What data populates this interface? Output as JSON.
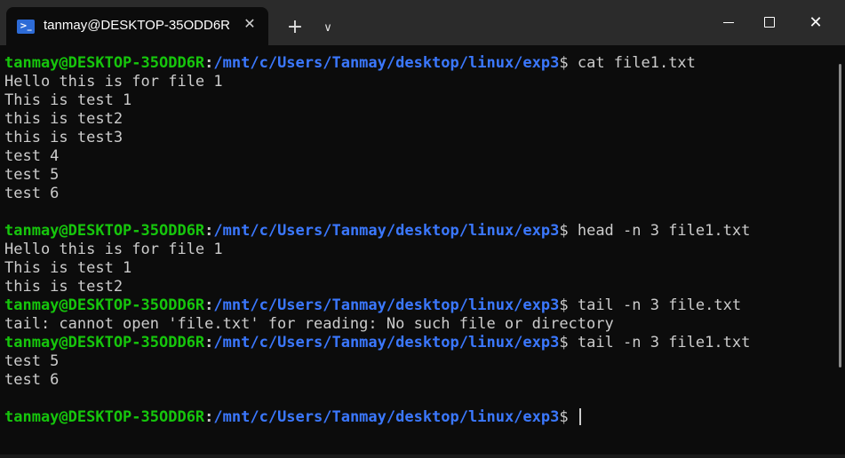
{
  "window": {
    "tab_title": "tanmay@DESKTOP-35ODD6R",
    "tab_icon": "powershell-icon",
    "close_tab_glyph": "✕",
    "new_tab_glyph": "+",
    "dropdown_glyph": "∨",
    "close_glyph": "✕"
  },
  "prompt": {
    "user": "tanmay@DESKTOP-35ODD6R",
    "colon": ":",
    "path": "/mnt/c/Users/Tanmay/desktop/linux/exp3",
    "dollar": "$ "
  },
  "lines": [
    {
      "type": "prompt",
      "cmd": "cat file1.txt"
    },
    {
      "type": "out",
      "text": "Hello this is for file 1"
    },
    {
      "type": "out",
      "text": "This is test 1"
    },
    {
      "type": "out",
      "text": "this is test2"
    },
    {
      "type": "out",
      "text": "this is test3"
    },
    {
      "type": "out",
      "text": "test 4"
    },
    {
      "type": "out",
      "text": "test 5"
    },
    {
      "type": "out",
      "text": "test 6"
    },
    {
      "type": "out",
      "text": ""
    },
    {
      "type": "prompt",
      "cmd": "head -n 3 file1.txt"
    },
    {
      "type": "out",
      "text": "Hello this is for file 1"
    },
    {
      "type": "out",
      "text": "This is test 1"
    },
    {
      "type": "out",
      "text": "this is test2"
    },
    {
      "type": "prompt",
      "cmd": "tail -n 3 file.txt"
    },
    {
      "type": "out",
      "text": "tail: cannot open 'file.txt' for reading: No such file or directory"
    },
    {
      "type": "prompt",
      "cmd": "tail -n 3 file1.txt"
    },
    {
      "type": "out",
      "text": "test 5"
    },
    {
      "type": "out",
      "text": "test 6"
    },
    {
      "type": "out",
      "text": ""
    },
    {
      "type": "prompt",
      "cmd": "",
      "cursor": true
    }
  ],
  "colors": {
    "user": "#16c60c",
    "path": "#3b78ff",
    "text": "#cccccc",
    "background": "#0c0c0c",
    "titlebar": "#2b2b2b"
  }
}
